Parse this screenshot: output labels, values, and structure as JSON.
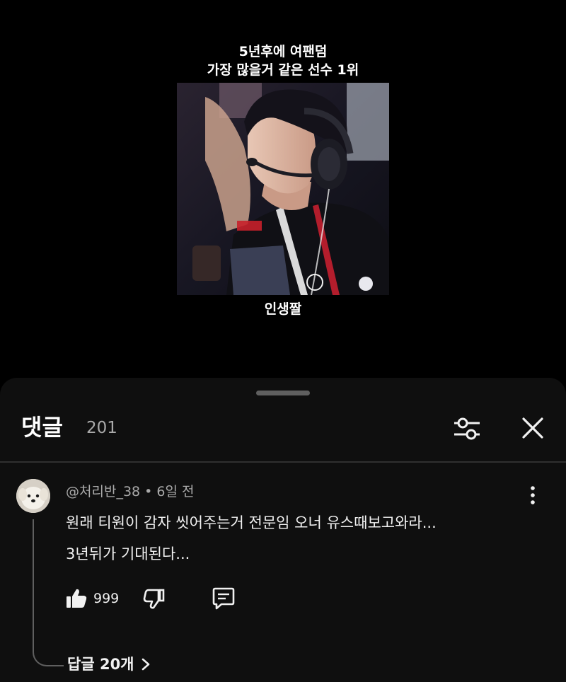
{
  "video": {
    "caption_top_line1": "5년후에 여팬덤",
    "caption_top_line2": "가장 많을거 같은 선수 1위",
    "caption_bottom": "인생짤"
  },
  "comments_panel": {
    "title": "댓글",
    "count": "201",
    "filter_icon": "sliders-icon",
    "close_icon": "close-icon"
  },
  "comment": {
    "author": "@처리반_38",
    "separator": "•",
    "time": "6일 전",
    "meta": "@처리반_38 • 6일 전",
    "text_line1": "원래 티원이 감자 씻어주는거 전문임 오너 유스때보고와라...",
    "text_line2": "3년뒤가 기대된다...",
    "likes": "999",
    "replies_label": "답글 20개"
  },
  "colors": {
    "background": "#000000",
    "sheet": "#0f0f0f",
    "primary_text": "#f1f1f1",
    "secondary_text": "#aaaaaa",
    "divider": "#303030"
  }
}
